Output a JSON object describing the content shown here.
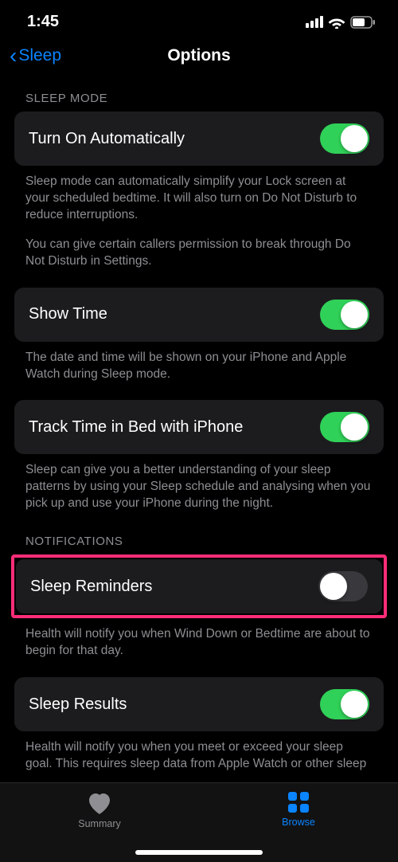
{
  "status": {
    "time": "1:45"
  },
  "nav": {
    "back": "Sleep",
    "title": "Options"
  },
  "sections": {
    "sleepMode": {
      "header": "SLEEP MODE",
      "autoOn": {
        "label": "Turn On Automatically",
        "on": true
      },
      "autoFooter1": "Sleep mode can automatically simplify your Lock screen at your scheduled bedtime. It will also turn on Do Not Disturb to reduce interruptions.",
      "autoFooter2": "You can give certain callers permission to break through Do Not Disturb in Settings.",
      "showTime": {
        "label": "Show Time",
        "on": true
      },
      "showTimeFooter": "The date and time will be shown on your iPhone and Apple Watch during Sleep mode.",
      "track": {
        "label": "Track Time in Bed with iPhone",
        "on": true
      },
      "trackFooter": "Sleep can give you a better understanding of your sleep patterns by using your Sleep schedule and analysing when you pick up and use your iPhone during the night."
    },
    "notifications": {
      "header": "NOTIFICATIONS",
      "reminders": {
        "label": "Sleep Reminders",
        "on": false
      },
      "remindersFooter": "Health will notify you when Wind Down or Bedtime are about to begin for that day.",
      "results": {
        "label": "Sleep Results",
        "on": true
      },
      "resultsFooter": "Health will notify you when you meet or exceed your sleep goal. This requires sleep data from Apple Watch or other sleep tracking apps and hardware."
    }
  },
  "tabs": {
    "summary": "Summary",
    "browse": "Browse"
  }
}
